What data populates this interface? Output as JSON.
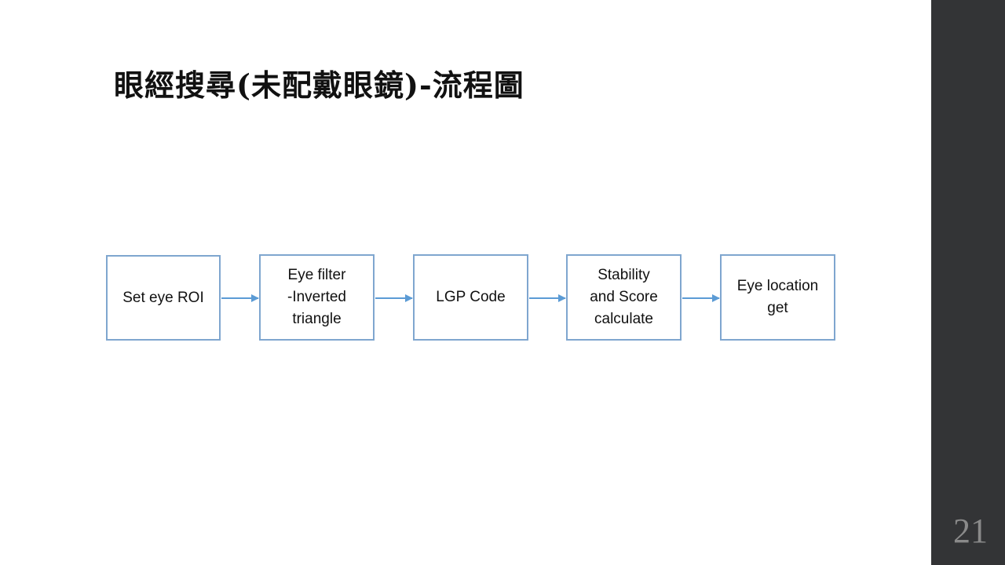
{
  "slide": {
    "title": "眼經搜尋(未配戴眼鏡)-流程圖",
    "page_number": "21"
  },
  "flowchart": {
    "steps": [
      {
        "label": "Set eye ROI"
      },
      {
        "label": "Eye filter\n-Inverted\ntriangle"
      },
      {
        "label": "LGP Code"
      },
      {
        "label": "Stability\nand Score\ncalculate"
      },
      {
        "label": "Eye location\nget"
      }
    ]
  },
  "colors": {
    "box_border": "#7fa6cf",
    "arrow": "#5b9bd5",
    "sidebar": "#333436",
    "page_number": "#8a8a8a"
  }
}
